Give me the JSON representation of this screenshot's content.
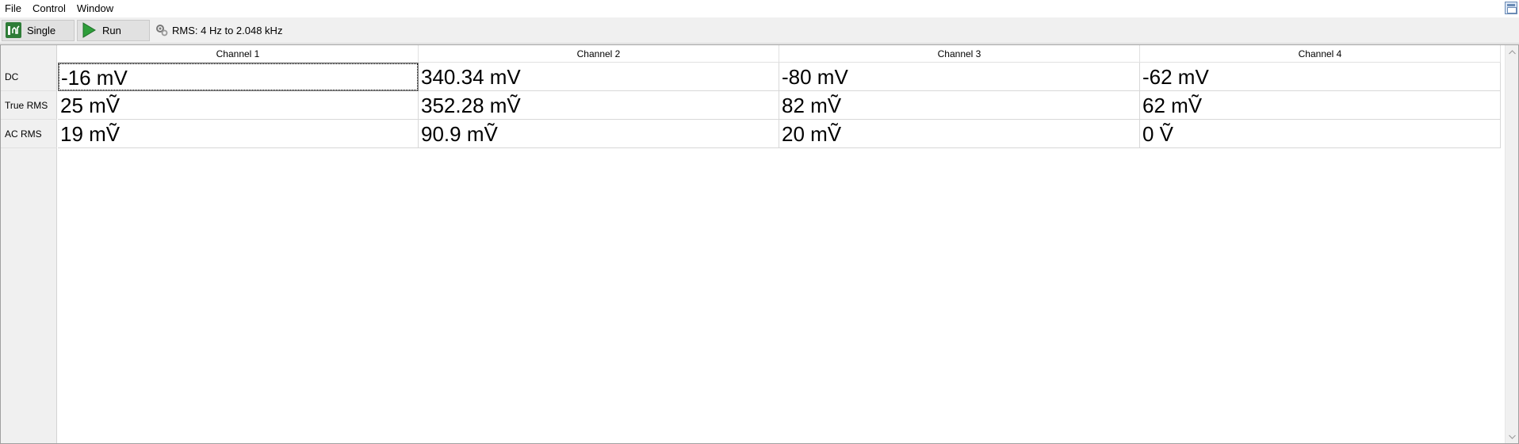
{
  "menu": {
    "items": [
      {
        "label": "File"
      },
      {
        "label": "Control"
      },
      {
        "label": "Window"
      }
    ]
  },
  "toolbar": {
    "single_label": "Single",
    "run_label": "Run",
    "status_text": "RMS: 4 Hz to 2.048 kHz"
  },
  "table": {
    "columns": [
      "Channel 1",
      "Channel 2",
      "Channel 3",
      "Channel 4"
    ],
    "rows": [
      {
        "label": "DC",
        "values": [
          "-16 mV",
          "340.34 mV",
          "-80 mV",
          "-62 mV"
        ]
      },
      {
        "label": "True RMS",
        "values": [
          "25 mṼ",
          "352.28 mṼ",
          "82 mṼ",
          "62 mṼ"
        ]
      },
      {
        "label": "AC RMS",
        "values": [
          "19 mṼ",
          "90.9 mṼ",
          "20 mṼ",
          "0 Ṽ"
        ]
      }
    ]
  },
  "colors": {
    "run_green": "#2e9e3a",
    "single_icon_green": "#2f7d38",
    "window_bg": "#f0f0f0"
  }
}
